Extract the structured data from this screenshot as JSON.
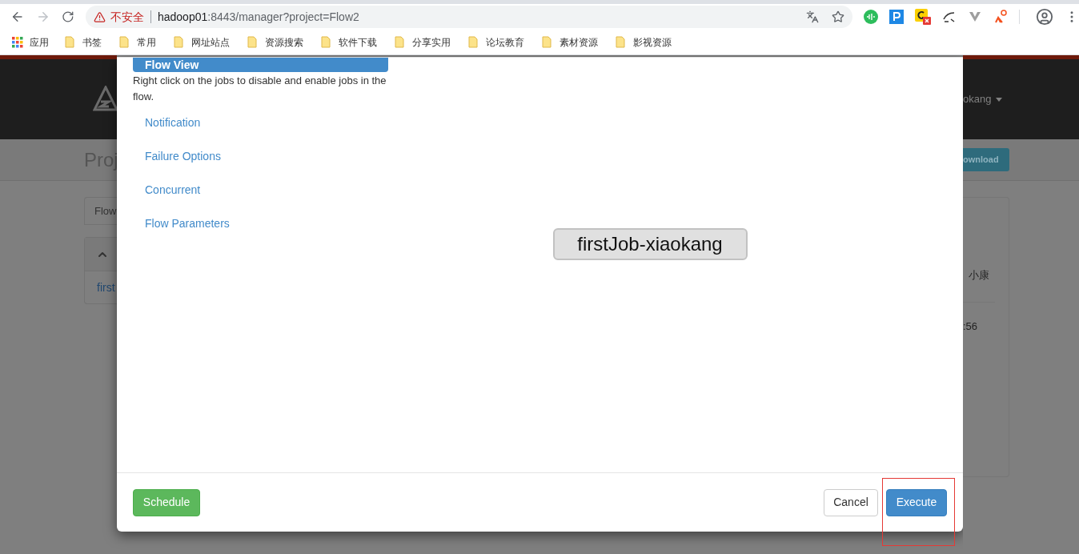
{
  "browser": {
    "security_label": "不安全",
    "url_host": "hadoop01",
    "url_rest": ":8443/manager?project=Flow2",
    "apps_label": "应用",
    "bookmarks": [
      "书签",
      "常用",
      "网址站点",
      "资源搜索",
      "软件下载",
      "分享实用",
      "论坛教育",
      "素材资源",
      "影视资源"
    ]
  },
  "background": {
    "page_title": "Proj",
    "tab_label": "Flow",
    "job_link": "first",
    "user_name": "okang",
    "download_label": "ownload",
    "owner": "小康",
    "time": ":56"
  },
  "modal": {
    "flow_view_label": "Flow View",
    "hint": "Right click on the jobs to disable and enable jobs in the flow.",
    "links": [
      "Notification",
      "Failure Options",
      "Concurrent",
      "Flow Parameters"
    ],
    "job_node": "firstJob-xiaokang",
    "buttons": [
      {
        "kind": "success",
        "label": "Schedule"
      },
      {
        "kind": "default",
        "label": "Cancel"
      },
      {
        "kind": "primary",
        "label": "Execute"
      }
    ]
  }
}
